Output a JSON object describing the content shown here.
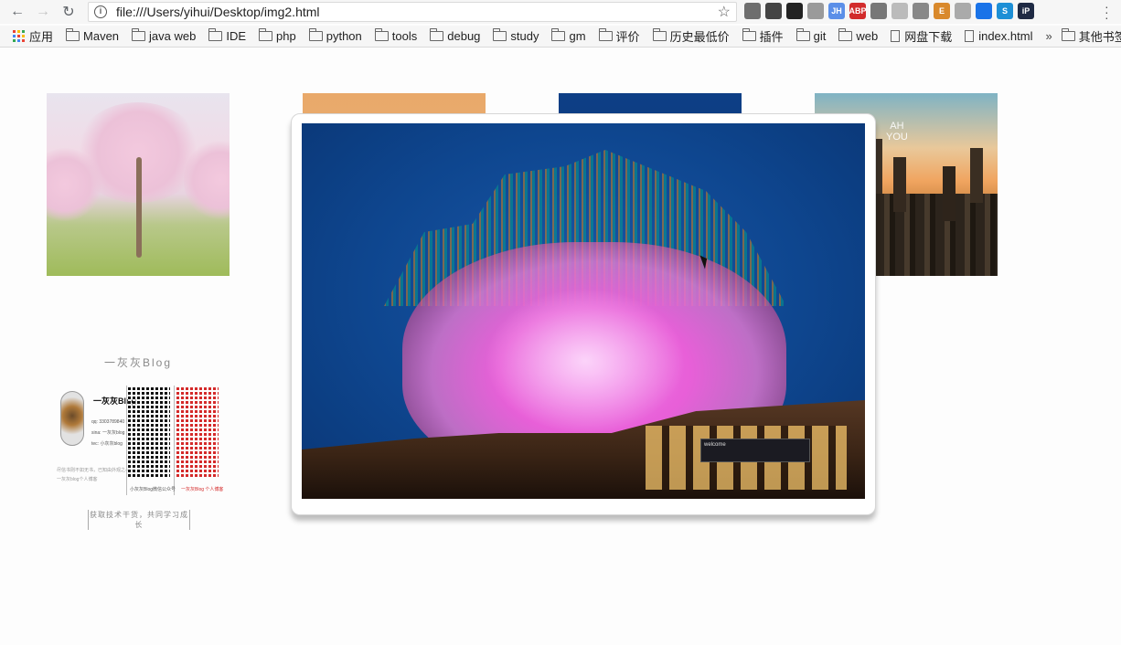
{
  "browser": {
    "url": "file:///Users/yihui/Desktop/img2.html",
    "icons": [
      "back-arrow-icon",
      "forward-arrow-icon",
      "reload-icon",
      "info-icon",
      "star-icon",
      "menu-dots-icon"
    ],
    "extensions": [
      {
        "name": "ext-puzzle-icon",
        "label": "",
        "color": "#6e6e6e"
      },
      {
        "name": "ext-qr-icon",
        "label": "",
        "color": "#444444"
      },
      {
        "name": "ext-qr2-icon",
        "label": "",
        "color": "#222222"
      },
      {
        "name": "ext-globe-icon",
        "label": "",
        "color": "#9a9a9a"
      },
      {
        "name": "ext-jh-icon",
        "label": "JH",
        "color": "#5b8fe8"
      },
      {
        "name": "ext-abp-icon",
        "label": "ABP",
        "color": "#d22b2b"
      },
      {
        "name": "ext-gear-icon",
        "label": "",
        "color": "#777777"
      },
      {
        "name": "ext-pepper-icon",
        "label": "",
        "color": "#bbbbbb"
      },
      {
        "name": "ext-check-icon",
        "label": "",
        "color": "#888888"
      },
      {
        "name": "ext-e-icon",
        "label": "E",
        "color": "#d9892c"
      },
      {
        "name": "ext-print-icon",
        "label": "",
        "color": "#aaaaaa"
      },
      {
        "name": "ext-download-icon",
        "label": "",
        "color": "#1a73e8"
      },
      {
        "name": "ext-s-icon",
        "label": "S",
        "color": "#1d8fd6"
      },
      {
        "name": "ext-ip-icon",
        "label": "iP",
        "color": "#1f2a44"
      }
    ]
  },
  "bookmarks": {
    "apps_label": "应用",
    "apps_colors": [
      "#ea4335",
      "#fbbc05",
      "#34a853",
      "#4285f4",
      "#ea4335",
      "#fbbc05",
      "#34a853",
      "#4285f4",
      "#ea4335"
    ],
    "items": [
      {
        "label": "Maven",
        "type": "folder"
      },
      {
        "label": "java web",
        "type": "folder"
      },
      {
        "label": "IDE",
        "type": "folder"
      },
      {
        "label": "php",
        "type": "folder"
      },
      {
        "label": "python",
        "type": "folder"
      },
      {
        "label": "tools",
        "type": "folder"
      },
      {
        "label": "debug",
        "type": "folder"
      },
      {
        "label": "study",
        "type": "folder"
      },
      {
        "label": "gm",
        "type": "folder"
      },
      {
        "label": "评价",
        "type": "folder"
      },
      {
        "label": "历史最低价",
        "type": "folder"
      },
      {
        "label": "插件",
        "type": "folder"
      },
      {
        "label": "git",
        "type": "folder"
      },
      {
        "label": "web",
        "type": "folder"
      },
      {
        "label": "网盘下载",
        "type": "page"
      },
      {
        "label": "index.html",
        "type": "page"
      }
    ],
    "overflow_label": "»",
    "other_label": "其他书签"
  },
  "gallery": {
    "thumb_sky_text": "AH\nYOU"
  },
  "blog_card": {
    "title": "一灰灰Blog",
    "name": "一灰灰Blog",
    "meta": [
      "qq: 3303789840",
      "sina: 一灰灰blog",
      "tec: 小灰灰blog"
    ],
    "motto": [
      "尽信书则不如无书，已知由外观之——",
      "一灰灰blog个人博客"
    ],
    "qr_a_caption": "小灰灰Blog微信公众号",
    "qr_b_caption": "一灰灰Blog 个人博客",
    "slogan": "获取技术干货，共同学习成长"
  },
  "preview": {
    "sign_text": "welcome"
  }
}
